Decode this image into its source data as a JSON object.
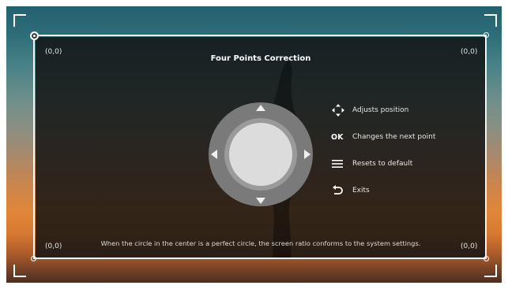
{
  "screen": {
    "title": "Four Points Correction",
    "corner_coordinates": {
      "top_left": "(0,0)",
      "top_right": "(0,0)",
      "bottom_left": "(0,0)",
      "bottom_right": "(0,0)"
    },
    "hints": [
      {
        "icon": "four-arrows-icon",
        "label": "Adjusts position"
      },
      {
        "icon": "ok-icon",
        "glyph": "OK",
        "label": "Changes the next point"
      },
      {
        "icon": "menu-icon",
        "label": "Resets to default"
      },
      {
        "icon": "back-icon",
        "label": "Exits"
      }
    ],
    "footer": "When the circle in the center is a perfect circle, the screen ratio conforms to the system settings.",
    "selected_corner": "top-left"
  },
  "colors": {
    "panel_overlay": "#121212",
    "frame_line": "#f2f2f2",
    "dpad_outer": "#7a7a7a",
    "dpad_ring": "#9a9a9a",
    "dpad_center": "#dcdcdc"
  }
}
